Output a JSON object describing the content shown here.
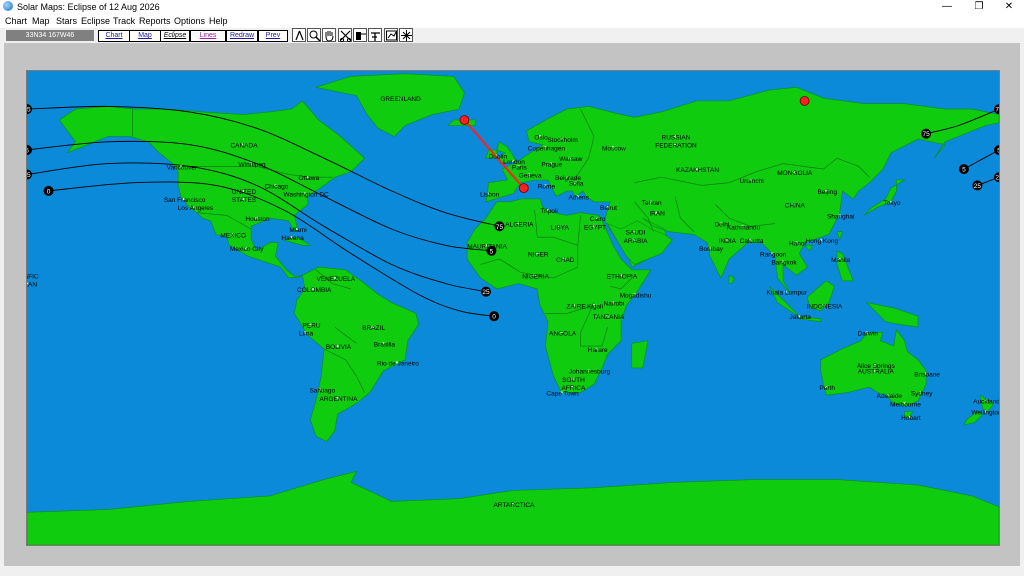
{
  "window": {
    "title": "Solar Maps: Eclipse of 12 Aug 2026",
    "minimize": "—",
    "restore": "❐",
    "close": "✕"
  },
  "menu": [
    "Chart",
    "Map",
    "Stars",
    "Eclipse",
    "Track",
    "Reports",
    "Options",
    "Help"
  ],
  "toolbar": {
    "coords": "33N34  167W46",
    "buttons": [
      "Chart",
      "Map",
      "Eclipse",
      "Lines",
      "Redraw",
      "Prev"
    ],
    "icons": [
      "compass-icon",
      "zoom-icon",
      "hand-icon",
      "scissors-icon",
      "ruler-icon",
      "crosshair-icon",
      "chart-icon",
      "star-icon"
    ]
  },
  "colors": {
    "ocean": "#0a8ad9",
    "land": "#0fcc0f",
    "path": "#ff1f1f",
    "lines": "#000000"
  },
  "map": {
    "labels": [
      {
        "text": "GREENLAND",
        "lon": -42,
        "lat": 74
      },
      {
        "text": "CANADA",
        "lon": -100,
        "lat": 57
      },
      {
        "text": "Winnipeg",
        "lon": -97,
        "lat": 50
      },
      {
        "text": "Vancouver",
        "lon": -123,
        "lat": 49
      },
      {
        "text": "Ottawa",
        "lon": -76,
        "lat": 45
      },
      {
        "text": "Chicago",
        "lon": -88,
        "lat": 42
      },
      {
        "text": "UNITED",
        "lon": -100,
        "lat": 40
      },
      {
        "text": "STATES",
        "lon": -100,
        "lat": 37
      },
      {
        "text": "Washington DC",
        "lon": -77,
        "lat": 39
      },
      {
        "text": "San Francisco",
        "lon": -122,
        "lat": 37
      },
      {
        "text": "Los Angeles",
        "lon": -118,
        "lat": 34
      },
      {
        "text": "Houston",
        "lon": -95,
        "lat": 30
      },
      {
        "text": "Miami",
        "lon": -80,
        "lat": 26
      },
      {
        "text": "Havana",
        "lon": -82,
        "lat": 23
      },
      {
        "text": "MEXICO",
        "lon": -104,
        "lat": 24
      },
      {
        "text": "Mexico City",
        "lon": -99,
        "lat": 19
      },
      {
        "text": "ACIFIC",
        "lon": -180,
        "lat": 9
      },
      {
        "text": "CEAN",
        "lon": -180,
        "lat": 6
      },
      {
        "text": "VENEZUELA",
        "lon": -66,
        "lat": 8
      },
      {
        "text": "COLOMBIA",
        "lon": -74,
        "lat": 4
      },
      {
        "text": "PERU",
        "lon": -75,
        "lat": -9
      },
      {
        "text": "Lima",
        "lon": -77,
        "lat": -12
      },
      {
        "text": "BRAZIL",
        "lon": -52,
        "lat": -10
      },
      {
        "text": "BOLIVIA",
        "lon": -65,
        "lat": -17
      },
      {
        "text": "Brasilia",
        "lon": -48,
        "lat": -16
      },
      {
        "text": "Rio de Janeiro",
        "lon": -43,
        "lat": -23
      },
      {
        "text": "Santiago",
        "lon": -71,
        "lat": -33
      },
      {
        "text": "ARGENTINA",
        "lon": -65,
        "lat": -36
      },
      {
        "text": "Oslo",
        "lon": 10,
        "lat": 60
      },
      {
        "text": "Stockholm",
        "lon": 18,
        "lat": 59
      },
      {
        "text": "Copenhagen",
        "lon": 12,
        "lat": 56
      },
      {
        "text": "Dublin",
        "lon": -6,
        "lat": 53
      },
      {
        "text": "London",
        "lon": 0,
        "lat": 51
      },
      {
        "text": "Paris",
        "lon": 2,
        "lat": 49
      },
      {
        "text": "Prague",
        "lon": 14,
        "lat": 50
      },
      {
        "text": "Warsaw",
        "lon": 21,
        "lat": 52
      },
      {
        "text": "Moscow",
        "lon": 37,
        "lat": 56
      },
      {
        "text": "RUSSIAN",
        "lon": 60,
        "lat": 60
      },
      {
        "text": "FEDERATION",
        "lon": 60,
        "lat": 57
      },
      {
        "text": "Geneva",
        "lon": 6,
        "lat": 46
      },
      {
        "text": "Belgrade",
        "lon": 20,
        "lat": 45
      },
      {
        "text": "Sofia",
        "lon": 23,
        "lat": 43
      },
      {
        "text": "Lisbon",
        "lon": -9,
        "lat": 39
      },
      {
        "text": "Rome",
        "lon": 12,
        "lat": 42
      },
      {
        "text": "Athens",
        "lon": 24,
        "lat": 38
      },
      {
        "text": "KAZAKHSTAN",
        "lon": 68,
        "lat": 48
      },
      {
        "text": "MONGOLIA",
        "lon": 104,
        "lat": 47
      },
      {
        "text": "Urumchi",
        "lon": 88,
        "lat": 44
      },
      {
        "text": "Beijing",
        "lon": 116,
        "lat": 40
      },
      {
        "text": "Tokyo",
        "lon": 140,
        "lat": 36
      },
      {
        "text": "Tripoli",
        "lon": 13,
        "lat": 33
      },
      {
        "text": "Beirut",
        "lon": 35,
        "lat": 34
      },
      {
        "text": "Tehran",
        "lon": 51,
        "lat": 36
      },
      {
        "text": "IRAN",
        "lon": 53,
        "lat": 32
      },
      {
        "text": "CHINA",
        "lon": 104,
        "lat": 35
      },
      {
        "text": "Shanghai",
        "lon": 121,
        "lat": 31
      },
      {
        "text": "ALGERIA",
        "lon": 2,
        "lat": 28
      },
      {
        "text": "LIBYA",
        "lon": 17,
        "lat": 27
      },
      {
        "text": "EGYPT",
        "lon": 30,
        "lat": 27
      },
      {
        "text": "Cairo",
        "lon": 31,
        "lat": 30
      },
      {
        "text": "SAUDI",
        "lon": 45,
        "lat": 25
      },
      {
        "text": "ARABIA",
        "lon": 45,
        "lat": 22
      },
      {
        "text": "Delhi",
        "lon": 77,
        "lat": 28
      },
      {
        "text": "Kathmandu",
        "lon": 85,
        "lat": 27
      },
      {
        "text": "INDIA",
        "lon": 79,
        "lat": 22
      },
      {
        "text": "Calcutta",
        "lon": 88,
        "lat": 22
      },
      {
        "text": "Hanoi",
        "lon": 105,
        "lat": 21
      },
      {
        "text": "Hong Kong",
        "lon": 114,
        "lat": 22
      },
      {
        "text": "Bombay",
        "lon": 73,
        "lat": 19
      },
      {
        "text": "Rangoon",
        "lon": 96,
        "lat": 17
      },
      {
        "text": "Bangkok",
        "lon": 100,
        "lat": 14
      },
      {
        "text": "Manila",
        "lon": 121,
        "lat": 15
      },
      {
        "text": "MAURITANIA",
        "lon": -10,
        "lat": 20
      },
      {
        "text": "NIGER",
        "lon": 9,
        "lat": 17
      },
      {
        "text": "CHAD",
        "lon": 19,
        "lat": 15
      },
      {
        "text": "NIGERIA",
        "lon": 8,
        "lat": 9
      },
      {
        "text": "ETHIOPIA",
        "lon": 40,
        "lat": 9
      },
      {
        "text": "Mogadishu",
        "lon": 45,
        "lat": 2
      },
      {
        "text": "Kuala Lumpur",
        "lon": 101,
        "lat": 3
      },
      {
        "text": "INDONESIA",
        "lon": 115,
        "lat": -2
      },
      {
        "text": "Jakarta",
        "lon": 106,
        "lat": -6
      },
      {
        "text": "ZAIRE",
        "lon": 23,
        "lat": -2
      },
      {
        "text": "Kigali",
        "lon": 30,
        "lat": -2
      },
      {
        "text": "Nairobi",
        "lon": 37,
        "lat": -1
      },
      {
        "text": "TANZANIA",
        "lon": 35,
        "lat": -6
      },
      {
        "text": "ANGOLA",
        "lon": 18,
        "lat": -12
      },
      {
        "text": "Harare",
        "lon": 31,
        "lat": -18
      },
      {
        "text": "Darwin",
        "lon": 131,
        "lat": -12
      },
      {
        "text": "Alice Springs",
        "lon": 134,
        "lat": -24
      },
      {
        "text": "AUSTRALIA",
        "lon": 134,
        "lat": -26
      },
      {
        "text": "Brisbane",
        "lon": 153,
        "lat": -27
      },
      {
        "text": "Johannesburg",
        "lon": 28,
        "lat": -26
      },
      {
        "text": "SOUTH",
        "lon": 22,
        "lat": -29
      },
      {
        "text": "AFRICA",
        "lon": 22,
        "lat": -32
      },
      {
        "text": "Cape Town",
        "lon": 18,
        "lat": -34
      },
      {
        "text": "Perth",
        "lon": 116,
        "lat": -32
      },
      {
        "text": "Adelaide",
        "lon": 139,
        "lat": -35
      },
      {
        "text": "Sydney",
        "lon": 151,
        "lat": -34
      },
      {
        "text": "Melbourne",
        "lon": 145,
        "lat": -38
      },
      {
        "text": "Auckland",
        "lon": 175,
        "lat": -37
      },
      {
        "text": "Wellington",
        "lon": 175,
        "lat": -41
      },
      {
        "text": "Hobart",
        "lon": 147,
        "lat": -43
      },
      {
        "text": "ARTARCTICA",
        "lon": 0,
        "lat": -75
      }
    ],
    "curves": [
      {
        "start_marker": "75",
        "end_marker": "75",
        "points": [
          [
            -180,
            70
          ],
          [
            -150,
            71
          ],
          [
            -120,
            69
          ],
          [
            -95,
            63
          ],
          [
            -70,
            52
          ],
          [
            -45,
            40
          ],
          [
            -25,
            32
          ],
          [
            -5,
            27
          ]
        ]
      },
      {
        "start_marker": "5",
        "end_marker": "5",
        "points": [
          [
            -180,
            55
          ],
          [
            -150,
            58
          ],
          [
            -120,
            57
          ],
          [
            -95,
            50
          ],
          [
            -70,
            38
          ],
          [
            -45,
            26
          ],
          [
            -25,
            20
          ],
          [
            -8,
            18
          ]
        ]
      },
      {
        "start_marker": "25",
        "end_marker": "25",
        "points": [
          [
            -180,
            46
          ],
          [
            -150,
            50
          ],
          [
            -120,
            49
          ],
          [
            -95,
            42
          ],
          [
            -70,
            27
          ],
          [
            -45,
            13
          ],
          [
            -25,
            6
          ],
          [
            -10,
            3
          ]
        ]
      },
      {
        "start_marker": "0",
        "end_marker": "0",
        "points": [
          [
            -172,
            40
          ],
          [
            -140,
            43
          ],
          [
            -110,
            42
          ],
          [
            -85,
            33
          ],
          [
            -60,
            17
          ],
          [
            -35,
            2
          ],
          [
            -20,
            -4
          ],
          [
            -7,
            -6
          ]
        ]
      }
    ],
    "right_curves": [
      {
        "start_marker": "75",
        "end_marker": "75",
        "points": [
          [
            153,
            61
          ],
          [
            165,
            64
          ],
          [
            180,
            70
          ]
        ]
      },
      {
        "start_marker": "5",
        "end_marker": "5",
        "points": [
          [
            167,
            48
          ],
          [
            180,
            55
          ]
        ]
      },
      {
        "start_marker": "25",
        "end_marker": "25",
        "points": [
          [
            172,
            42
          ],
          [
            180,
            45
          ]
        ]
      }
    ],
    "eclipse_path": {
      "start": {
        "lon": -18,
        "lat": 66
      },
      "mid": {
        "lon": -4,
        "lat": 50
      },
      "end": {
        "lon": 4,
        "lat": 41
      },
      "marker_arctic": {
        "lon": 108,
        "lat": 73
      }
    }
  }
}
